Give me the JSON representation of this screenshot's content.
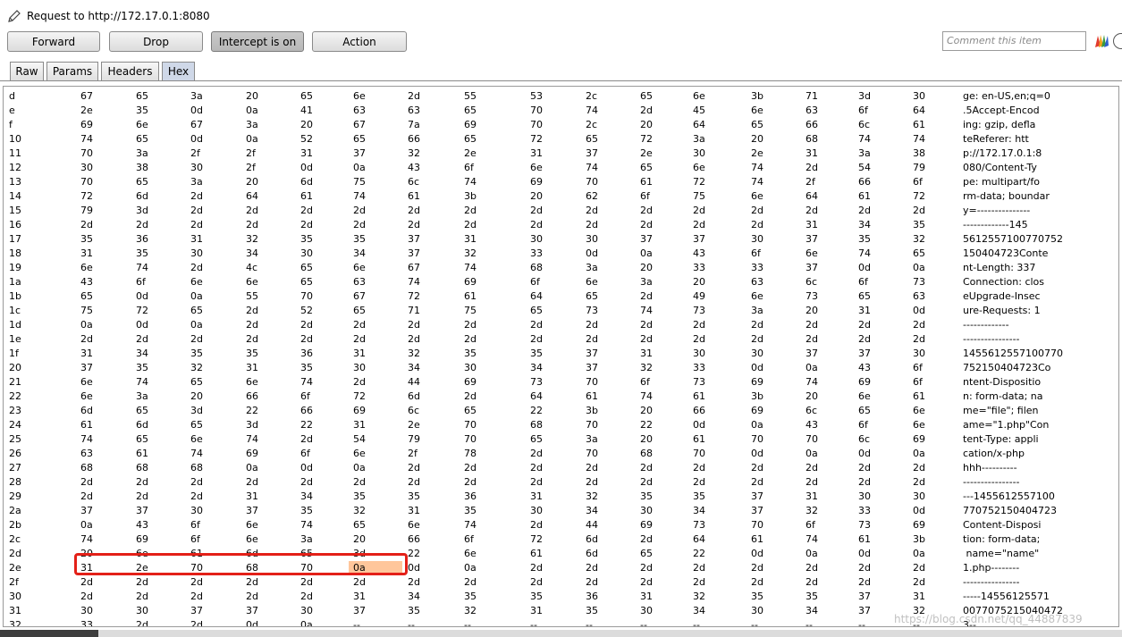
{
  "window": {
    "title": "Request to http://172.17.0.1:8080"
  },
  "toolbar": {
    "buttons": [
      {
        "label": "Forward",
        "active": false
      },
      {
        "label": "Drop",
        "active": false
      },
      {
        "label": "Intercept is on",
        "active": true
      },
      {
        "label": "Action",
        "active": false
      }
    ],
    "comment_placeholder": "Comment this item"
  },
  "tabs": [
    {
      "label": "Raw",
      "selected": false
    },
    {
      "label": "Params",
      "selected": false
    },
    {
      "label": "Headers",
      "selected": false
    },
    {
      "label": "Hex",
      "selected": true
    }
  ],
  "hex_rows": [
    {
      "label": "d",
      "bytes": [
        "67",
        "65",
        "3a",
        "20",
        "65",
        "6e",
        "2d",
        "55",
        "53",
        "2c",
        "65",
        "6e",
        "3b",
        "71",
        "3d",
        "30"
      ],
      "ascii": "ge: en-US,en;q=0"
    },
    {
      "label": "e",
      "bytes": [
        "2e",
        "35",
        "0d",
        "0a",
        "41",
        "63",
        "63",
        "65",
        "70",
        "74",
        "2d",
        "45",
        "6e",
        "63",
        "6f",
        "64"
      ],
      "ascii": ".5Accept-Encod"
    },
    {
      "label": "f",
      "bytes": [
        "69",
        "6e",
        "67",
        "3a",
        "20",
        "67",
        "7a",
        "69",
        "70",
        "2c",
        "20",
        "64",
        "65",
        "66",
        "6c",
        "61"
      ],
      "ascii": "ing: gzip, defla"
    },
    {
      "label": "10",
      "bytes": [
        "74",
        "65",
        "0d",
        "0a",
        "52",
        "65",
        "66",
        "65",
        "72",
        "65",
        "72",
        "3a",
        "20",
        "68",
        "74",
        "74"
      ],
      "ascii": "teReferer: htt"
    },
    {
      "label": "11",
      "bytes": [
        "70",
        "3a",
        "2f",
        "2f",
        "31",
        "37",
        "32",
        "2e",
        "31",
        "37",
        "2e",
        "30",
        "2e",
        "31",
        "3a",
        "38"
      ],
      "ascii": "p://172.17.0.1:8"
    },
    {
      "label": "12",
      "bytes": [
        "30",
        "38",
        "30",
        "2f",
        "0d",
        "0a",
        "43",
        "6f",
        "6e",
        "74",
        "65",
        "6e",
        "74",
        "2d",
        "54",
        "79"
      ],
      "ascii": "080/Content-Ty"
    },
    {
      "label": "13",
      "bytes": [
        "70",
        "65",
        "3a",
        "20",
        "6d",
        "75",
        "6c",
        "74",
        "69",
        "70",
        "61",
        "72",
        "74",
        "2f",
        "66",
        "6f"
      ],
      "ascii": "pe: multipart/fo"
    },
    {
      "label": "14",
      "bytes": [
        "72",
        "6d",
        "2d",
        "64",
        "61",
        "74",
        "61",
        "3b",
        "20",
        "62",
        "6f",
        "75",
        "6e",
        "64",
        "61",
        "72"
      ],
      "ascii": "rm-data; boundar"
    },
    {
      "label": "15",
      "bytes": [
        "79",
        "3d",
        "2d",
        "2d",
        "2d",
        "2d",
        "2d",
        "2d",
        "2d",
        "2d",
        "2d",
        "2d",
        "2d",
        "2d",
        "2d",
        "2d"
      ],
      "ascii": "y=---------------"
    },
    {
      "label": "16",
      "bytes": [
        "2d",
        "2d",
        "2d",
        "2d",
        "2d",
        "2d",
        "2d",
        "2d",
        "2d",
        "2d",
        "2d",
        "2d",
        "2d",
        "31",
        "34",
        "35"
      ],
      "ascii": "-------------145"
    },
    {
      "label": "17",
      "bytes": [
        "35",
        "36",
        "31",
        "32",
        "35",
        "35",
        "37",
        "31",
        "30",
        "30",
        "37",
        "37",
        "30",
        "37",
        "35",
        "32"
      ],
      "ascii": "5612557100770752"
    },
    {
      "label": "18",
      "bytes": [
        "31",
        "35",
        "30",
        "34",
        "30",
        "34",
        "37",
        "32",
        "33",
        "0d",
        "0a",
        "43",
        "6f",
        "6e",
        "74",
        "65"
      ],
      "ascii": "150404723Conte"
    },
    {
      "label": "19",
      "bytes": [
        "6e",
        "74",
        "2d",
        "4c",
        "65",
        "6e",
        "67",
        "74",
        "68",
        "3a",
        "20",
        "33",
        "33",
        "37",
        "0d",
        "0a"
      ],
      "ascii": "nt-Length: 337"
    },
    {
      "label": "1a",
      "bytes": [
        "43",
        "6f",
        "6e",
        "6e",
        "65",
        "63",
        "74",
        "69",
        "6f",
        "6e",
        "3a",
        "20",
        "63",
        "6c",
        "6f",
        "73"
      ],
      "ascii": "Connection: clos"
    },
    {
      "label": "1b",
      "bytes": [
        "65",
        "0d",
        "0a",
        "55",
        "70",
        "67",
        "72",
        "61",
        "64",
        "65",
        "2d",
        "49",
        "6e",
        "73",
        "65",
        "63"
      ],
      "ascii": "eUpgrade-Insec"
    },
    {
      "label": "1c",
      "bytes": [
        "75",
        "72",
        "65",
        "2d",
        "52",
        "65",
        "71",
        "75",
        "65",
        "73",
        "74",
        "73",
        "3a",
        "20",
        "31",
        "0d"
      ],
      "ascii": "ure-Requests: 1"
    },
    {
      "label": "1d",
      "bytes": [
        "0a",
        "0d",
        "0a",
        "2d",
        "2d",
        "2d",
        "2d",
        "2d",
        "2d",
        "2d",
        "2d",
        "2d",
        "2d",
        "2d",
        "2d",
        "2d"
      ],
      "ascii": "-------------"
    },
    {
      "label": "1e",
      "bytes": [
        "2d",
        "2d",
        "2d",
        "2d",
        "2d",
        "2d",
        "2d",
        "2d",
        "2d",
        "2d",
        "2d",
        "2d",
        "2d",
        "2d",
        "2d",
        "2d"
      ],
      "ascii": "----------------"
    },
    {
      "label": "1f",
      "bytes": [
        "31",
        "34",
        "35",
        "35",
        "36",
        "31",
        "32",
        "35",
        "35",
        "37",
        "31",
        "30",
        "30",
        "37",
        "37",
        "30"
      ],
      "ascii": "1455612557100770"
    },
    {
      "label": "20",
      "bytes": [
        "37",
        "35",
        "32",
        "31",
        "35",
        "30",
        "34",
        "30",
        "34",
        "37",
        "32",
        "33",
        "0d",
        "0a",
        "43",
        "6f"
      ],
      "ascii": "752150404723Co"
    },
    {
      "label": "21",
      "bytes": [
        "6e",
        "74",
        "65",
        "6e",
        "74",
        "2d",
        "44",
        "69",
        "73",
        "70",
        "6f",
        "73",
        "69",
        "74",
        "69",
        "6f"
      ],
      "ascii": "ntent-Dispositio"
    },
    {
      "label": "22",
      "bytes": [
        "6e",
        "3a",
        "20",
        "66",
        "6f",
        "72",
        "6d",
        "2d",
        "64",
        "61",
        "74",
        "61",
        "3b",
        "20",
        "6e",
        "61"
      ],
      "ascii": "n: form-data; na"
    },
    {
      "label": "23",
      "bytes": [
        "6d",
        "65",
        "3d",
        "22",
        "66",
        "69",
        "6c",
        "65",
        "22",
        "3b",
        "20",
        "66",
        "69",
        "6c",
        "65",
        "6e"
      ],
      "ascii": "me=\"file\"; filen"
    },
    {
      "label": "24",
      "bytes": [
        "61",
        "6d",
        "65",
        "3d",
        "22",
        "31",
        "2e",
        "70",
        "68",
        "70",
        "22",
        "0d",
        "0a",
        "43",
        "6f",
        "6e"
      ],
      "ascii": "ame=\"1.php\"Con"
    },
    {
      "label": "25",
      "bytes": [
        "74",
        "65",
        "6e",
        "74",
        "2d",
        "54",
        "79",
        "70",
        "65",
        "3a",
        "20",
        "61",
        "70",
        "70",
        "6c",
        "69"
      ],
      "ascii": "tent-Type: appli"
    },
    {
      "label": "26",
      "bytes": [
        "63",
        "61",
        "74",
        "69",
        "6f",
        "6e",
        "2f",
        "78",
        "2d",
        "70",
        "68",
        "70",
        "0d",
        "0a",
        "0d",
        "0a"
      ],
      "ascii": "cation/x-php"
    },
    {
      "label": "27",
      "bytes": [
        "68",
        "68",
        "68",
        "0a",
        "0d",
        "0a",
        "2d",
        "2d",
        "2d",
        "2d",
        "2d",
        "2d",
        "2d",
        "2d",
        "2d",
        "2d"
      ],
      "ascii": "hhh----------"
    },
    {
      "label": "28",
      "bytes": [
        "2d",
        "2d",
        "2d",
        "2d",
        "2d",
        "2d",
        "2d",
        "2d",
        "2d",
        "2d",
        "2d",
        "2d",
        "2d",
        "2d",
        "2d",
        "2d"
      ],
      "ascii": "----------------"
    },
    {
      "label": "29",
      "bytes": [
        "2d",
        "2d",
        "2d",
        "31",
        "34",
        "35",
        "35",
        "36",
        "31",
        "32",
        "35",
        "35",
        "37",
        "31",
        "30",
        "30"
      ],
      "ascii": "---1455612557100"
    },
    {
      "label": "2a",
      "bytes": [
        "37",
        "37",
        "30",
        "37",
        "35",
        "32",
        "31",
        "35",
        "30",
        "34",
        "30",
        "34",
        "37",
        "32",
        "33",
        "0d"
      ],
      "ascii": "770752150404723"
    },
    {
      "label": "2b",
      "bytes": [
        "0a",
        "43",
        "6f",
        "6e",
        "74",
        "65",
        "6e",
        "74",
        "2d",
        "44",
        "69",
        "73",
        "70",
        "6f",
        "73",
        "69"
      ],
      "ascii": "Content-Disposi"
    },
    {
      "label": "2c",
      "bytes": [
        "74",
        "69",
        "6f",
        "6e",
        "3a",
        "20",
        "66",
        "6f",
        "72",
        "6d",
        "2d",
        "64",
        "61",
        "74",
        "61",
        "3b"
      ],
      "ascii": "tion: form-data;"
    },
    {
      "label": "2d",
      "bytes": [
        "20",
        "6e",
        "61",
        "6d",
        "65",
        "3d",
        "22",
        "6e",
        "61",
        "6d",
        "65",
        "22",
        "0d",
        "0a",
        "0d",
        "0a"
      ],
      "ascii": " name=\"name\""
    },
    {
      "label": "2e",
      "bytes": [
        "31",
        "2e",
        "70",
        "68",
        "70",
        "0a",
        "0d",
        "0a",
        "2d",
        "2d",
        "2d",
        "2d",
        "2d",
        "2d",
        "2d",
        "2d"
      ],
      "ascii": "1.php--------"
    },
    {
      "label": "2f",
      "bytes": [
        "2d",
        "2d",
        "2d",
        "2d",
        "2d",
        "2d",
        "2d",
        "2d",
        "2d",
        "2d",
        "2d",
        "2d",
        "2d",
        "2d",
        "2d",
        "2d"
      ],
      "ascii": "----------------"
    },
    {
      "label": "30",
      "bytes": [
        "2d",
        "2d",
        "2d",
        "2d",
        "2d",
        "31",
        "34",
        "35",
        "35",
        "36",
        "31",
        "32",
        "35",
        "35",
        "37",
        "31"
      ],
      "ascii": "-----14556125571"
    },
    {
      "label": "31",
      "bytes": [
        "30",
        "30",
        "37",
        "37",
        "30",
        "37",
        "35",
        "32",
        "31",
        "35",
        "30",
        "34",
        "30",
        "34",
        "37",
        "32"
      ],
      "ascii": "0077075215040472"
    },
    {
      "label": "32",
      "bytes": [
        "33",
        "2d",
        "2d",
        "0d",
        "0a",
        "--",
        "--",
        "--",
        "--",
        "--",
        "--",
        "--",
        "--",
        "--",
        "--",
        "--"
      ],
      "ascii": "3--"
    }
  ],
  "selection": {
    "row_label": "2e",
    "byte_index": 5
  },
  "colors": {
    "selected_cell": "#ffc69b",
    "annotation_box": "#e32018",
    "selected_tab": "#cfd8e8"
  },
  "watermark": "https://blog.csdn.net/qq_44887839"
}
